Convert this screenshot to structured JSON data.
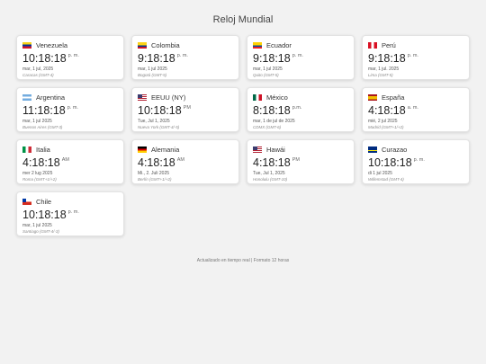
{
  "page": {
    "title": "Reloj Mundial",
    "footer": "Actualizado en tiempo real | Formato 12 horas"
  },
  "clocks": [
    {
      "country": "Venezuela",
      "flag": "venezuela-flag-icon",
      "time": "10:18:18",
      "ampm": "p. m.",
      "date": "mar, 1 jul, 2025",
      "tz": "Caracas (GMT-4)"
    },
    {
      "country": "Colombia",
      "flag": "colombia-flag-icon",
      "time": "9:18:18",
      "ampm": "p. m.",
      "date": "mar, 1 jul 2025",
      "tz": "Bogotá (GMT-5)"
    },
    {
      "country": "Ecuador",
      "flag": "ecuador-flag-icon",
      "time": "9:18:18",
      "ampm": "p. m.",
      "date": "mar, 1 jul 2025",
      "tz": "Quito (GMT-5)"
    },
    {
      "country": "Perú",
      "flag": "peru-flag-icon",
      "time": "9:18:18",
      "ampm": "p. m.",
      "date": "mar, 1 jul. 2025",
      "tz": "Lima (GMT-5)"
    },
    {
      "country": "Argentina",
      "flag": "argentina-flag-icon",
      "time": "11:18:18",
      "ampm": "p. m.",
      "date": "mar, 1 jul 2025",
      "tz": "Buenos Aires (GMT-3)"
    },
    {
      "country": "EEUU (NY)",
      "flag": "usa-flag-icon",
      "time": "10:18:18",
      "ampm": "PM",
      "date": "Tue, Jul 1, 2025",
      "tz": "Nueva York (GMT-4/-5)"
    },
    {
      "country": "México",
      "flag": "mexico-flag-icon",
      "time": "8:18:18",
      "ampm": "p.m.",
      "date": "mar, 1 de jul de 2025",
      "tz": "CDMX (GMT-6)"
    },
    {
      "country": "España",
      "flag": "spain-flag-icon",
      "time": "4:18:18",
      "ampm": "a. m.",
      "date": "mié, 2 jul 2025",
      "tz": "Madrid (GMT+1/+2)"
    },
    {
      "country": "Italia",
      "flag": "italy-flag-icon",
      "time": "4:18:18",
      "ampm": "AM",
      "date": "mer 2 lug 2025",
      "tz": "Roma (GMT+1/+2)"
    },
    {
      "country": "Alemania",
      "flag": "germany-flag-icon",
      "time": "4:18:18",
      "ampm": "AM",
      "date": "Mi., 2. Juli 2025",
      "tz": "Berlín (GMT+1/+2)"
    },
    {
      "country": "Hawái",
      "flag": "usa-flag-icon",
      "time": "4:18:18",
      "ampm": "PM",
      "date": "Tue, Jul 1, 2025",
      "tz": "Honolulu (GMT-10)"
    },
    {
      "country": "Curazao",
      "flag": "curacao-flag-icon",
      "time": "10:18:18",
      "ampm": "p. m.",
      "date": "di 1 jul 2025",
      "tz": "Willemstad (GMT-4)"
    },
    {
      "country": "Chile",
      "flag": "chile-flag-icon",
      "time": "10:18:18",
      "ampm": "p. m.",
      "date": "mar, 1 jul 2025",
      "tz": "Santiago (GMT-4/-3)"
    }
  ]
}
